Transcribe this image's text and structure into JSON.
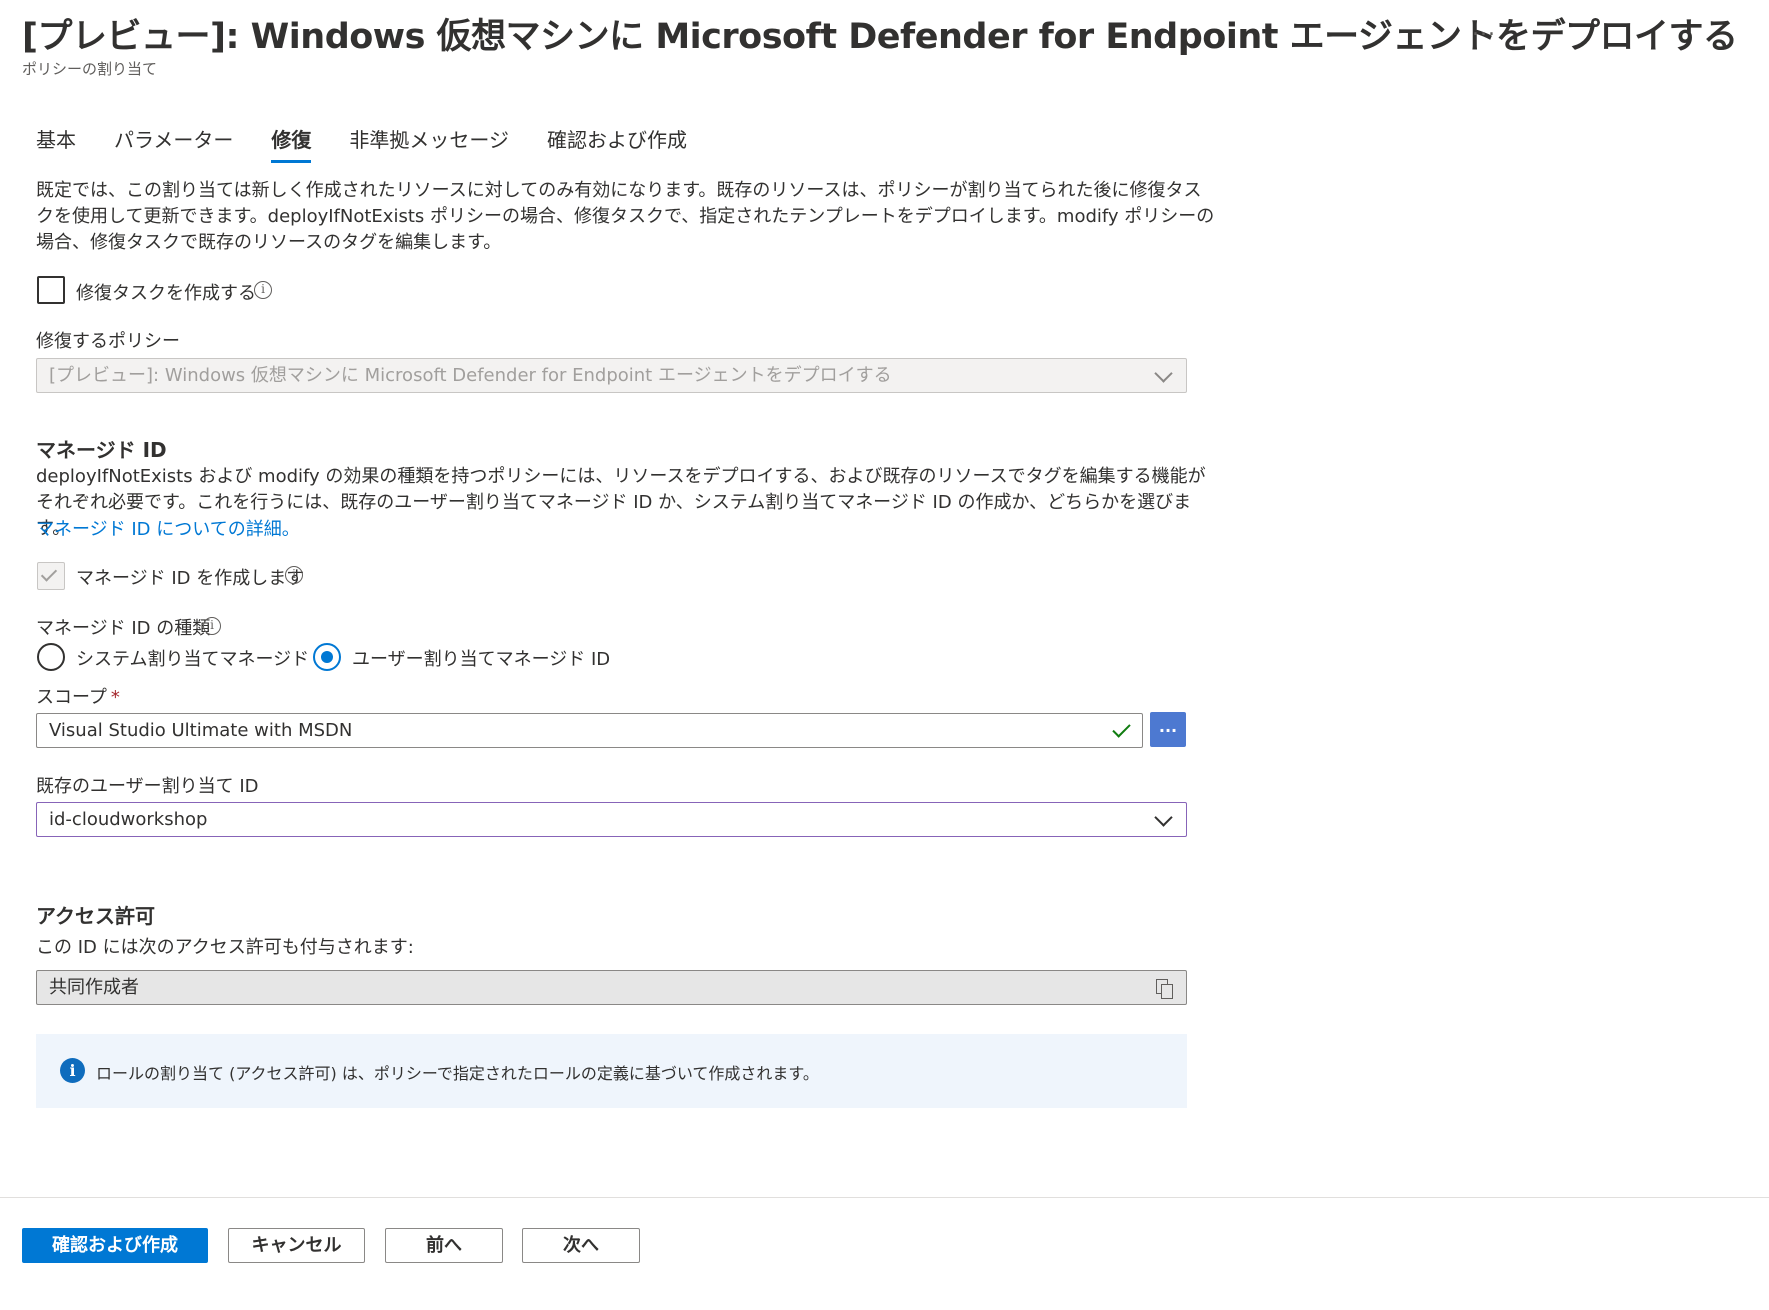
{
  "header": {
    "title": "[プレビュー]: Windows 仮想マシンに Microsoft Defender for Endpoint エージェントをデプロイする",
    "subtitle": "ポリシーの割り当て",
    "more": "..."
  },
  "tabs": [
    {
      "label": "基本",
      "active": false
    },
    {
      "label": "パラメーター",
      "active": false
    },
    {
      "label": "修復",
      "active": true
    },
    {
      "label": "非準拠メッセージ",
      "active": false
    },
    {
      "label": "確認および作成",
      "active": false
    }
  ],
  "remediation": {
    "description": "既定では、この割り当ては新しく作成されたリソースに対してのみ有効になります。既存のリソースは、ポリシーが割り当てられた後に修復タスクを使用して更新できます。deployIfNotExists ポリシーの場合、修復タスクで、指定されたテンプレートをデプロイします。modify ポリシーの場合、修復タスクで既存のリソースのタグを編集します。",
    "create_task_label": "修復タスクを作成する",
    "create_task_checked": false,
    "policy_label": "修復するポリシー",
    "policy_value": "[プレビュー]: Windows 仮想マシンに Microsoft Defender for Endpoint エージェントをデプロイする"
  },
  "managed_id": {
    "heading": "マネージド ID",
    "description": "deployIfNotExists および modify の効果の種類を持つポリシーには、リソースをデプロイする、および既存のリソースでタグを編集する機能がそれぞれ必要です。これを行うには、既存のユーザー割り当てマネージド ID か、システム割り当てマネージド ID の作成か、どちらかを選びます。",
    "learn_more": "マネージド ID についての詳細。",
    "create_label": "マネージド ID を作成します",
    "create_checked": true,
    "type_label": "マネージド ID の種類",
    "type_options": [
      {
        "label": "システム割り当てマネージド ID",
        "selected": false
      },
      {
        "label": "ユーザー割り当てマネージド ID",
        "selected": true
      }
    ],
    "scope_label": "スコープ",
    "scope_required": "*",
    "scope_value": "Visual Studio Ultimate with MSDN",
    "browse_label": "...",
    "existing_label": "既存のユーザー割り当て ID",
    "existing_value": "id-cloudworkshop"
  },
  "access": {
    "heading": "アクセス許可",
    "description": "この ID には次のアクセス許可も付与されます:",
    "role_value": "共同作成者",
    "info_icon": "i",
    "info_text": "ロールの割り当て (アクセス許可) は、ポリシーで指定されたロールの定義に基づいて作成されます。"
  },
  "footer": {
    "review_create": "確認および作成",
    "cancel": "キャンセル",
    "previous": "前へ",
    "next": "次へ"
  },
  "colors": {
    "accent": "#0078d4",
    "success": "#107c10",
    "required": "#a4262c",
    "focus_border": "#8764b8"
  }
}
